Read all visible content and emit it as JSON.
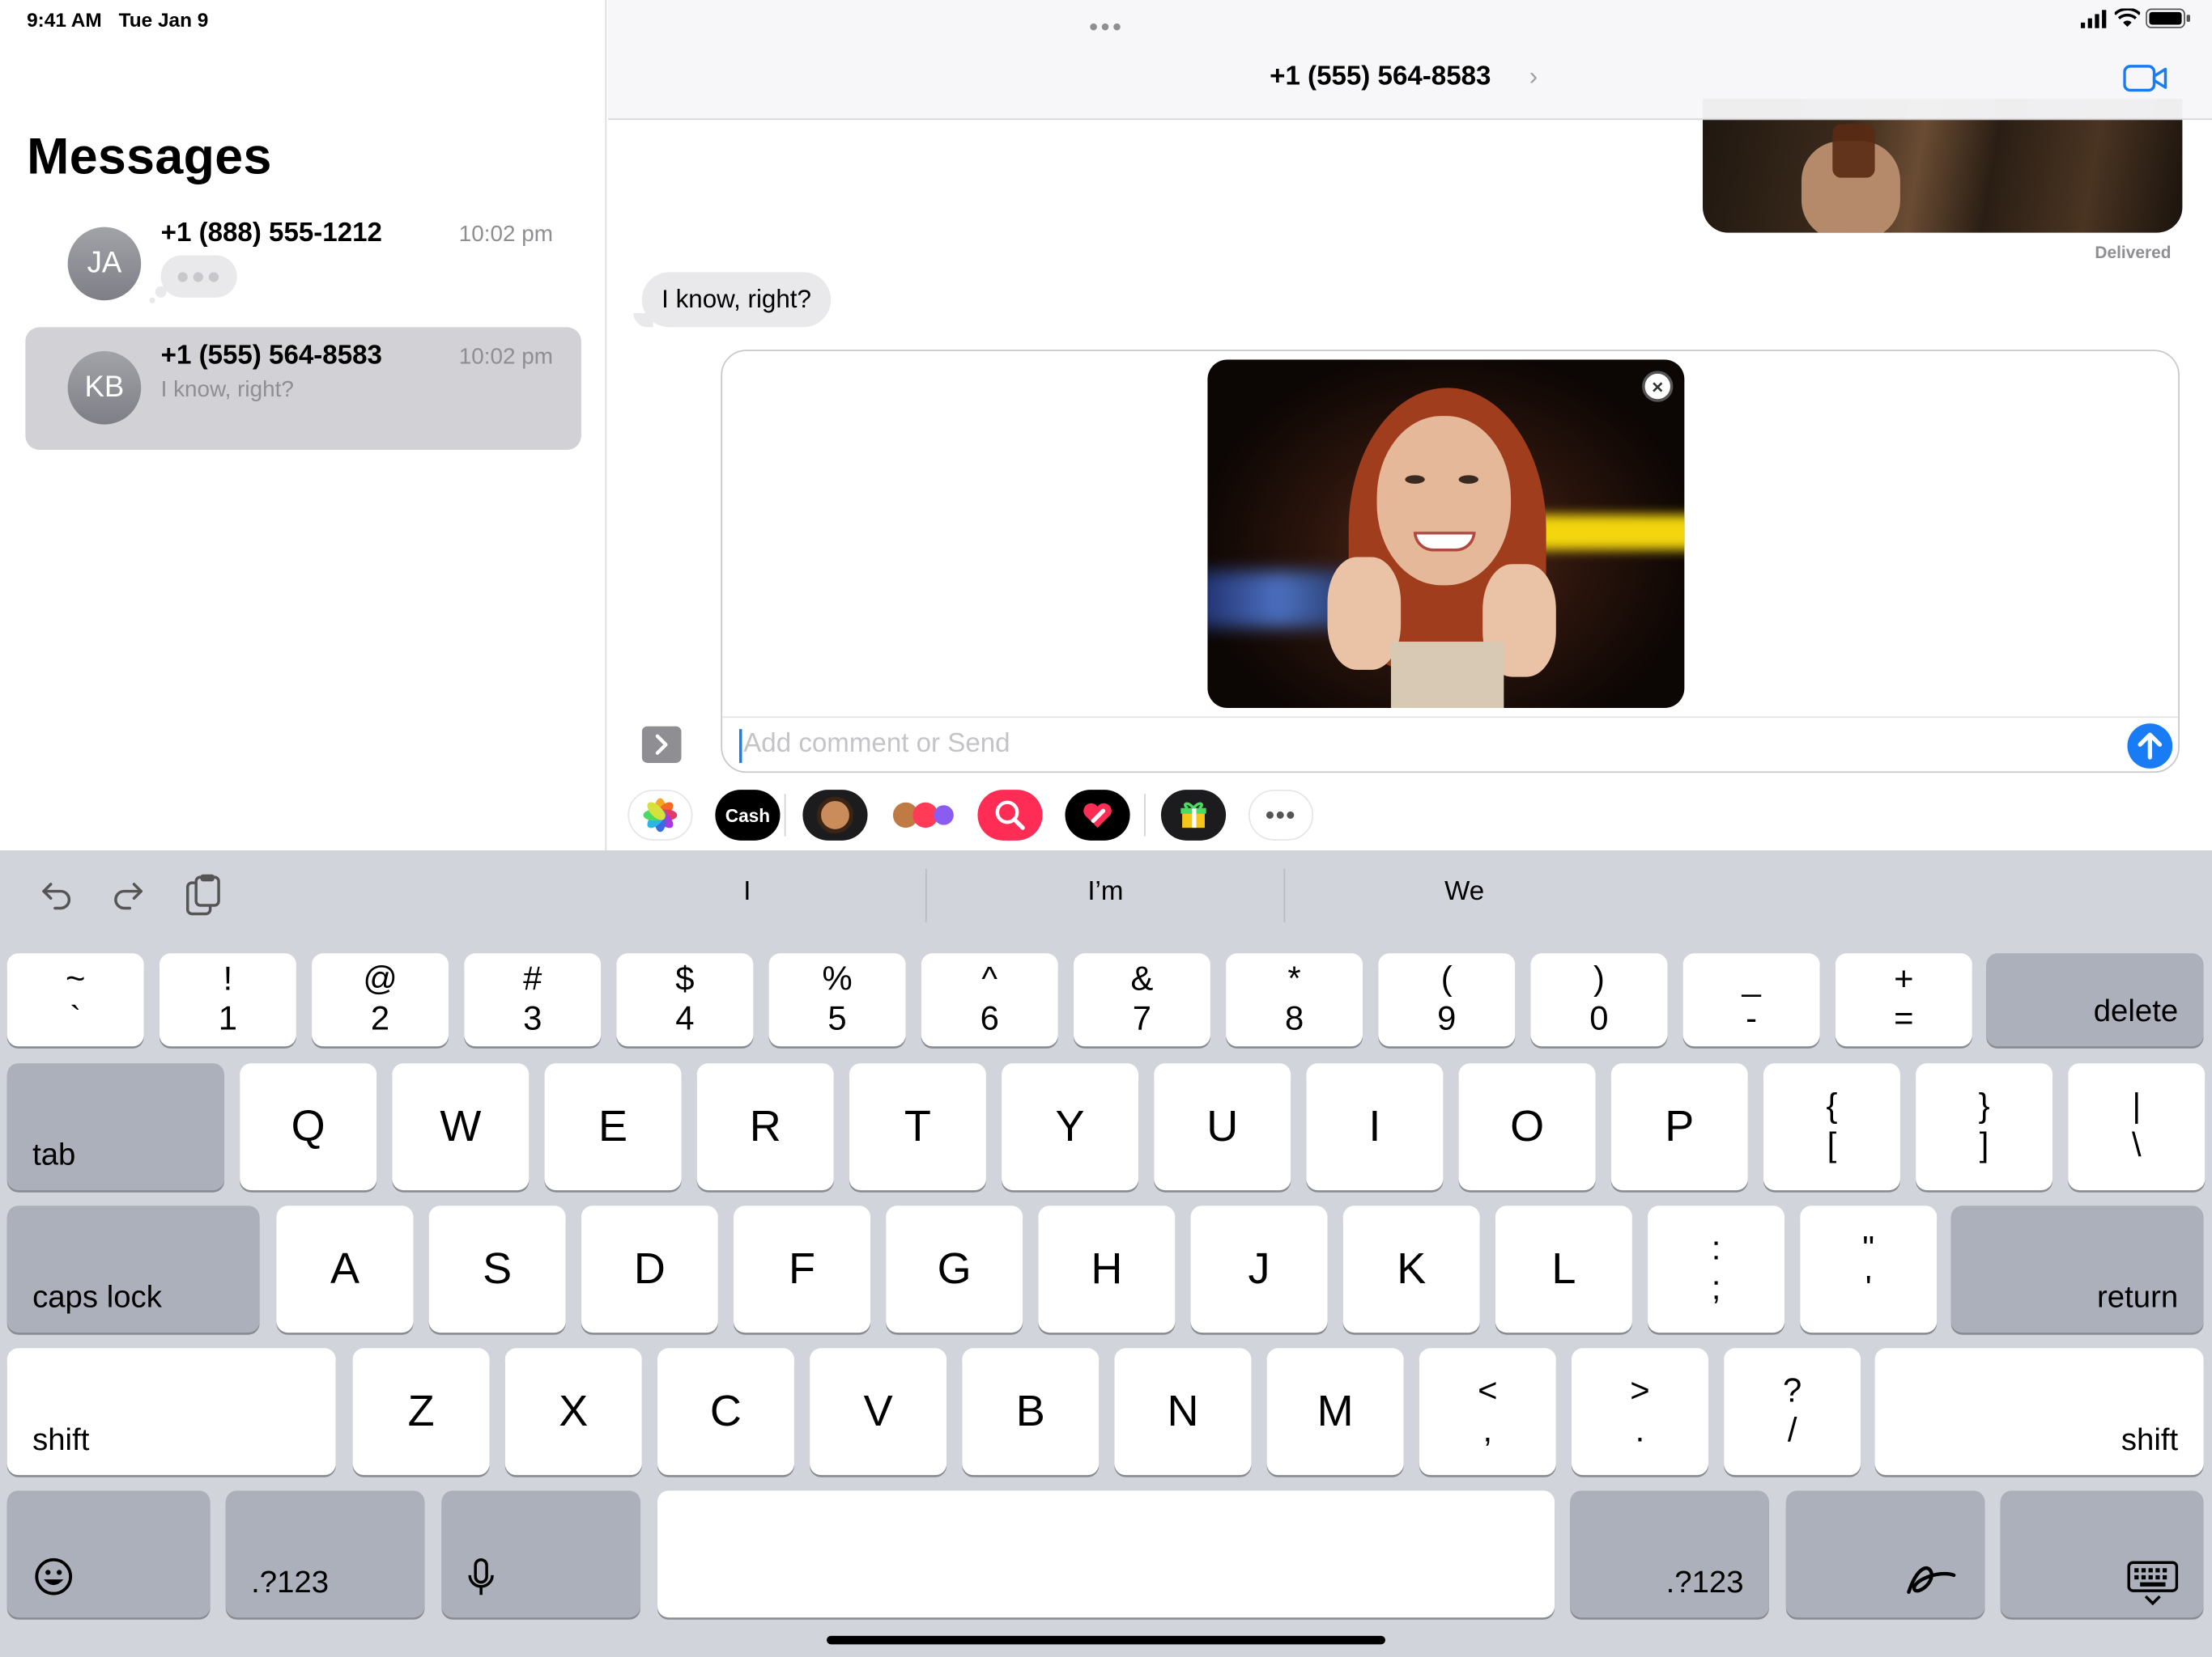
{
  "status_bar": {
    "time": "9:41 AM",
    "date": "Tue Jan 9"
  },
  "sidebar": {
    "title": "Messages",
    "conversations": [
      {
        "initials": "JA",
        "name": "+1 (888) 555-1212",
        "time": "10:02 pm",
        "preview": "",
        "typing": true,
        "selected": false
      },
      {
        "initials": "KB",
        "name": "+1 (555) 564-8583",
        "time": "10:02 pm",
        "preview": "I know, right?",
        "typing": false,
        "selected": true
      }
    ]
  },
  "chat": {
    "contact": "+1 (555) 564-8583",
    "delivered_label": "Delivered",
    "incoming_message": "I know, right?",
    "composer_placeholder": "Add comment or Send"
  },
  "app_strip": [
    {
      "icon": "photos-icon"
    },
    {
      "icon": "apple-cash-icon",
      "label": "Cash"
    },
    {
      "icon": "memoji-icon"
    },
    {
      "icon": "animoji-stickers-icon"
    },
    {
      "icon": "image-search-icon"
    },
    {
      "icon": "digital-touch-icon"
    },
    {
      "icon": "gift-icon"
    },
    {
      "icon": "more-apps-icon"
    }
  ],
  "predictions": [
    "I",
    "I’m",
    "We"
  ],
  "keyboard": {
    "number_row": [
      {
        "top": "~",
        "bottom": "`"
      },
      {
        "top": "!",
        "bottom": "1"
      },
      {
        "top": "@",
        "bottom": "2"
      },
      {
        "top": "#",
        "bottom": "3"
      },
      {
        "top": "$",
        "bottom": "4"
      },
      {
        "top": "%",
        "bottom": "5"
      },
      {
        "top": "^",
        "bottom": "6"
      },
      {
        "top": "&",
        "bottom": "7"
      },
      {
        "top": "*",
        "bottom": "8"
      },
      {
        "top": "(",
        "bottom": "9"
      },
      {
        "top": ")",
        "bottom": "0"
      },
      {
        "top": "_",
        "bottom": "-"
      },
      {
        "top": "+",
        "bottom": "="
      }
    ],
    "delete": "delete",
    "tab": "tab",
    "row_q": [
      "Q",
      "W",
      "E",
      "R",
      "T",
      "Y",
      "U",
      "I",
      "O",
      "P"
    ],
    "row_q_sym": [
      {
        "top": "{",
        "bottom": "["
      },
      {
        "top": "}",
        "bottom": "]"
      },
      {
        "top": "|",
        "bottom": "\\"
      }
    ],
    "caps_lock": "caps lock",
    "row_a": [
      "A",
      "S",
      "D",
      "F",
      "G",
      "H",
      "J",
      "K",
      "L"
    ],
    "row_a_sym": [
      {
        "top": ":",
        "bottom": ";"
      },
      {
        "top": "\"",
        "bottom": "'"
      }
    ],
    "return": "return",
    "shift": "shift",
    "row_z": [
      "Z",
      "X",
      "C",
      "V",
      "B",
      "N",
      "M"
    ],
    "row_z_sym": [
      {
        "top": "<",
        "bottom": ","
      },
      {
        "top": ">",
        "bottom": "."
      },
      {
        "top": "?",
        "bottom": "/"
      }
    ],
    "numbers_key": ".?123"
  },
  "colors": {
    "accent": "#1a7cf5",
    "keyboard_bg": "#d1d4da",
    "dark_key": "#abb0ba"
  }
}
